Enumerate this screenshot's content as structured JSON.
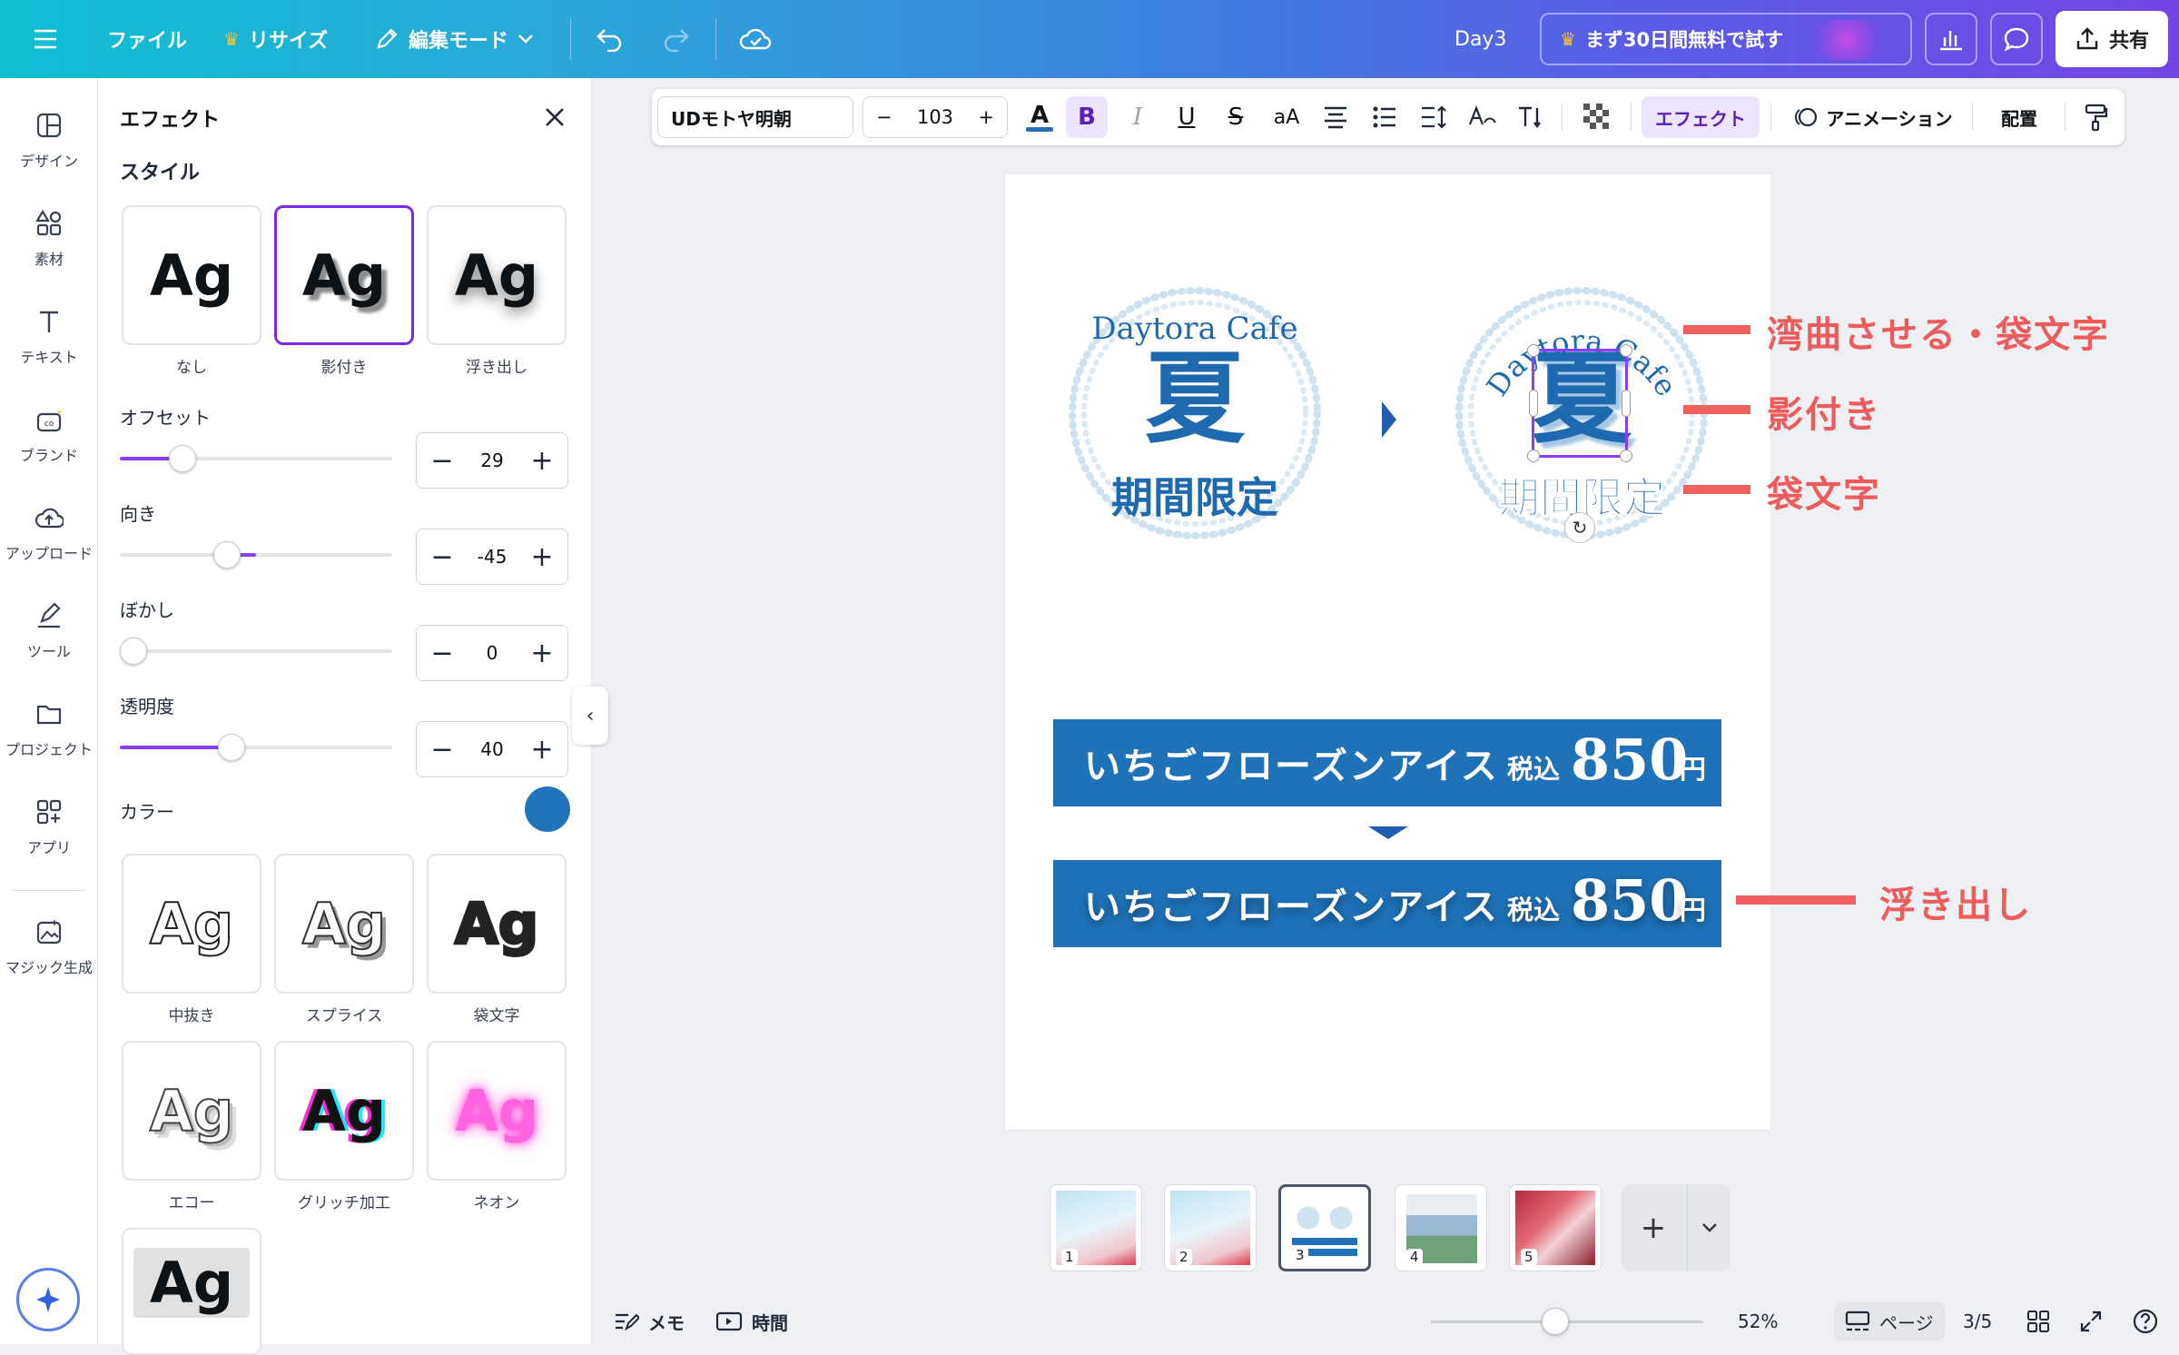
{
  "header": {
    "file": "ファイル",
    "resize": "リサイズ",
    "edit_mode": "編集モード",
    "doc_title": "Day3",
    "trial": "まず30日間無料で試す",
    "share": "共有"
  },
  "rail": {
    "items": [
      "デザイン",
      "素材",
      "テキスト",
      "ブランド",
      "アップロード",
      "ツール",
      "プロジェクト",
      "アプリ",
      "マジック生成"
    ]
  },
  "panel": {
    "title": "エフェクト",
    "style_heading": "スタイル",
    "styles_top": [
      {
        "label": "なし",
        "sample": "Ag"
      },
      {
        "label": "影付き",
        "sample": "Ag"
      },
      {
        "label": "浮き出し",
        "sample": "Ag"
      }
    ],
    "offset_label": "オフセット",
    "offset_value": "29",
    "offset_level": 0.2,
    "direction_label": "向き",
    "direction_value": "-45",
    "direction_level": 0.38,
    "blur_label": "ぼかし",
    "blur_value": "0",
    "blur_level": 0,
    "transparency_label": "透明度",
    "transparency_value": "40",
    "transparency_level": 0.4,
    "color_label": "カラー",
    "color_value": "#1f74bb",
    "styles_more": [
      {
        "label": "中抜き",
        "sample": "Ag"
      },
      {
        "label": "スプライス",
        "sample": "Ag"
      },
      {
        "label": "袋文字",
        "sample": "Ag"
      },
      {
        "label": "エコー",
        "sample": "Ag"
      },
      {
        "label": "グリッチ加工",
        "sample": "Ag"
      },
      {
        "label": "ネオン",
        "sample": "Ag"
      },
      {
        "label": "",
        "sample": "Ag"
      }
    ]
  },
  "toolbar": {
    "font": "UDモトヤ明朝",
    "size": "103",
    "case": "aA",
    "effects": "エフェクト",
    "animation": "アニメーション",
    "position": "配置"
  },
  "canvas": {
    "badge_left": {
      "top": "Daytora Cafe",
      "main": "夏",
      "bottom": "期間限定"
    },
    "badge_right": {
      "top": "Daytora Cafe",
      "main": "夏",
      "bottom": "期間限定"
    },
    "banner_top": {
      "name": "いちごフローズンアイス",
      "tax": "税込",
      "price": "850",
      "yen": "円"
    },
    "banner_bottom": {
      "name": "いちごフローズンアイス",
      "tax": "税込",
      "price": "850",
      "yen": "円"
    },
    "annotations": [
      "湾曲させる・袋文字",
      "影付き",
      "袋文字",
      "浮き出し"
    ],
    "accent": "#1f72b8",
    "annotation_color": "#ee5b5b"
  },
  "pages": [
    "1",
    "2",
    "3",
    "4",
    "5"
  ],
  "bottom": {
    "notes": "メモ",
    "time": "時間",
    "zoom": "52%",
    "zoom_level": 0.45,
    "pages_label": "ページ",
    "page_count": "3/5"
  }
}
